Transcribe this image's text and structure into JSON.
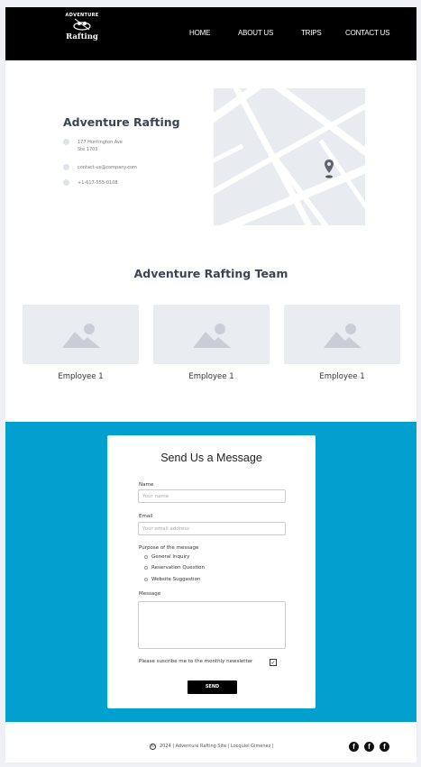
{
  "header": {
    "logo": {
      "top_text": "ADVENTURE",
      "main_text": "Rafting"
    },
    "nav": [
      "HOME",
      "ABOUT US",
      "TRIPS",
      "CONTACT US"
    ]
  },
  "contact": {
    "company_name": "Adventure Rafting",
    "address_line1": "177 Huntington Ave",
    "address_line2": "Ste 1703",
    "email": "contact-us@company.com",
    "phone": "+1-617-555-0108",
    "map_pin_icon": "map-pin-icon"
  },
  "team": {
    "title": "Adventure Rafting Team",
    "members": [
      {
        "name": "Employee 1"
      },
      {
        "name": "Employee 1"
      },
      {
        "name": "Employee 1"
      }
    ]
  },
  "form": {
    "title": "Send Us a Message",
    "name_label": "Name",
    "name_placeholder": "Your name",
    "email_label": "Email",
    "email_placeholder": "Your email address",
    "purpose_label": "Purpose of the message",
    "purpose_options": [
      "General Inquiry",
      "Reservation Question",
      "Website Suggestion"
    ],
    "message_label": "Message",
    "newsletter_label": "Please suscribe me to the monthly newsletter",
    "newsletter_checked": true,
    "send_label": "SEND"
  },
  "footer": {
    "copyright_symbol": "©",
    "text": "2024 | Adventure Rafting Site | Locquiel Gimenez |",
    "social_icons": [
      "facebook-icon",
      "facebook-icon",
      "facebook-icon"
    ],
    "social_glyph": "f"
  },
  "colors": {
    "header_bg": "#000000",
    "section_blue": "#02a0cf",
    "heading_text": "#3b4455"
  }
}
